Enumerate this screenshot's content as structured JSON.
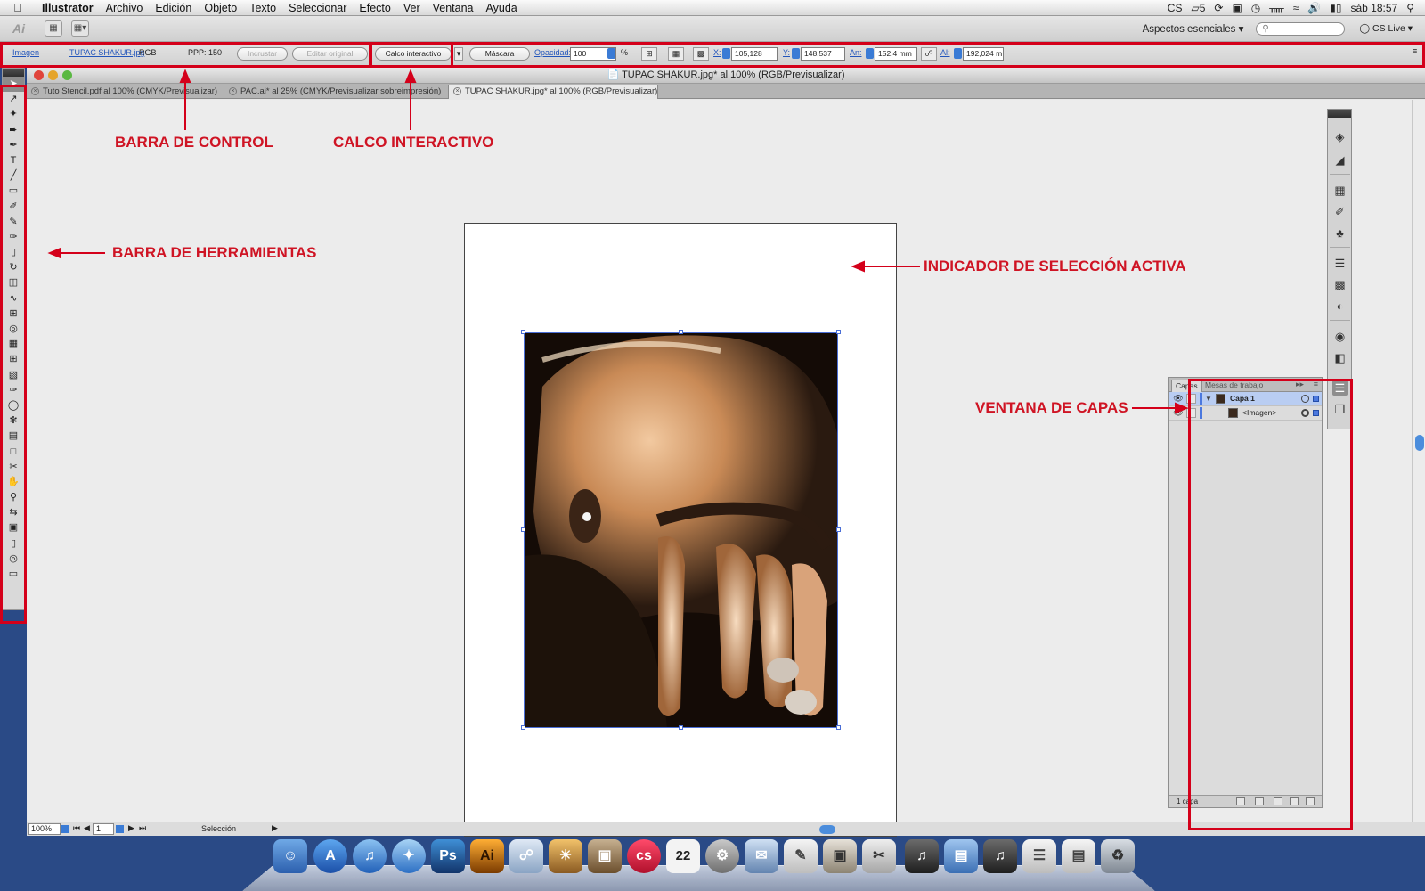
{
  "menubar": {
    "apple": "",
    "app_name": "Illustrator",
    "items": [
      "Archivo",
      "Edición",
      "Objeto",
      "Texto",
      "Seleccionar",
      "Efecto",
      "Ver",
      "Ventana",
      "Ayuda"
    ],
    "status": {
      "adobe_cs": "CS",
      "adobe_count": "5",
      "clock": "sáb 18:57"
    }
  },
  "appbar": {
    "logo": "Ai",
    "workspace_label": "Aspectos esenciales ▾",
    "search_placeholder": "",
    "cs_live": "CS Live ▾"
  },
  "controlbar": {
    "object_type": "Imagen",
    "filename": "TUPAC SHAKUR.jpg",
    "color_mode": "RGB",
    "ppi": "PPP: 150",
    "embed_button": "Incrustar",
    "edit_original_button": "Editar original",
    "live_trace_button": "Calco interactivo",
    "mask_button": "Máscara",
    "opacity_label": "Opacidad:",
    "opacity_value": "100",
    "percent": "%",
    "x_label": "X:",
    "x_value": "105,128 mm",
    "y_label": "Y:",
    "y_value": "148,537 mm",
    "w_label": "An:",
    "w_value": "152,4 mm",
    "h_label": "Al:",
    "h_value": "192,024 m"
  },
  "document": {
    "title": "TUPAC SHAKUR.jpg* al 100% (RGB/Previsualizar)",
    "tabs": [
      {
        "label": "Tuto Stencil.pdf al 100% (CMYK/Previsualizar)",
        "active": false
      },
      {
        "label": "PAC.ai* al 25% (CMYK/Previsualizar sobreimpresión)",
        "active": false
      },
      {
        "label": "TUPAC SHAKUR.jpg* al 100% (RGB/Previsualizar)",
        "active": true
      }
    ],
    "status": {
      "zoom": "100%",
      "page": "1",
      "mode": "Selección"
    }
  },
  "layers_panel": {
    "tab_layers": "Capas",
    "tab_artboards": "Mesas de trabajo",
    "rows": [
      {
        "name": "Capa 1",
        "selected": true
      },
      {
        "name": "<Imagen>",
        "selected": false
      }
    ],
    "footer": "1 capa"
  },
  "annotations": {
    "control_bar": "BARRA DE CONTROL",
    "live_trace": "CALCO INTERACTIVO",
    "toolbar": "BARRA DE HERRAMIENTAS",
    "active_selection": "INDICADOR DE SELECCIÓN ACTIVA",
    "layers_window": "VENTANA DE CAPAS"
  },
  "colors": {
    "annotation_red": "#d4001a",
    "selection_blue": "#4a6ed6"
  },
  "dock": {
    "apps": [
      "finder",
      "app-store",
      "itunes",
      "safari",
      "Ps",
      "Ai",
      "preview",
      "iphoto",
      "photos",
      "lastfm",
      "calendar",
      "system-prefs",
      "mail",
      "textedit",
      "preview-doc",
      "scissors",
      "music",
      "folder",
      "music-2",
      "document",
      "document-2",
      "trash"
    ],
    "calendar_day": "22",
    "ps_label": "Ps",
    "ai_label": "Ai"
  }
}
